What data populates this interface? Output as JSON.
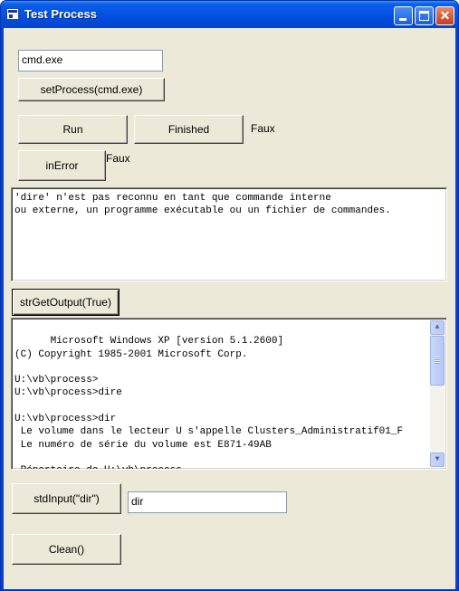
{
  "window": {
    "title": "Test Process"
  },
  "controls": {
    "process_input": "cmd.exe",
    "set_process_label": "setProcess(cmd.exe)",
    "run_label": "Run",
    "finished_label": "Finished",
    "finished_value": "Faux",
    "in_error_label": "inError",
    "in_error_value": "Faux",
    "error_output": "'dire' n'est pas reconnu en tant que commande interne\nou externe, un programme exécutable ou un fichier de commandes.",
    "get_output_label": "strGetOutput(True)",
    "console_output": "Microsoft Windows XP [version 5.1.2600]\n(C) Copyright 1985-2001 Microsoft Corp.\n\nU:\\vb\\process>\nU:\\vb\\process>dire\n\nU:\\vb\\process>dir\n Le volume dans le lecteur U s'appelle Clusters_Administratif01_F\n Le numéro de série du volume est E871-49AB\n\n Répertoire de U:\\vb\\process",
    "std_input_label": "stdInput(\"dir\")",
    "std_input_value": "dir",
    "clean_label": "Clean()"
  },
  "icons": {
    "app": "window-app-icon",
    "minimize": "minimize-icon",
    "maximize": "maximize-icon",
    "close": "close-icon",
    "scroll_up": "scroll-up-arrow-icon",
    "scroll_down": "scroll-down-arrow-icon"
  }
}
